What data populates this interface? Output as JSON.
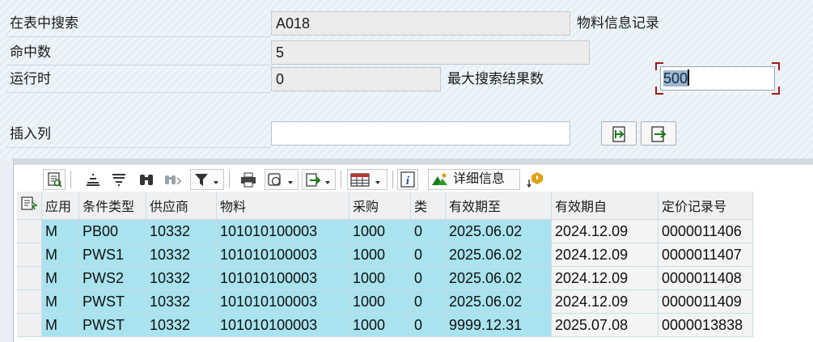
{
  "form": {
    "search_in_table": {
      "label": "在表中搜索",
      "value": "A018",
      "side_label": "物料信息记录"
    },
    "hits": {
      "label": "命中数",
      "value": "5"
    },
    "runtime": {
      "label": "运行时",
      "value": "0",
      "side_label": "最大搜索结果数"
    },
    "max_results": {
      "value": "500"
    },
    "insert_column": {
      "label": "插入列",
      "value": ""
    }
  },
  "toolbar": {
    "details_label": "详细信息",
    "icons": [
      "details-icon",
      "sort-ascending-icon",
      "sort-descending-icon",
      "find-icon",
      "find-next-icon",
      "filter-icon",
      "print-icon",
      "views-icon",
      "export-icon",
      "layout-icon",
      "info-icon",
      "detail-info-icon",
      "abc-analysis-icon"
    ]
  },
  "table": {
    "columns": [
      "应用",
      "条件类型",
      "供应商",
      "物料",
      "采购",
      "类",
      "有效期至",
      "有效期自",
      "定价记录号"
    ],
    "rows": [
      [
        "M",
        "PB00",
        "10332",
        "101010100003",
        "1000",
        "0",
        "2025.06.02",
        "2024.12.09",
        "0000011406"
      ],
      [
        "M",
        "PWS1",
        "10332",
        "101010100003",
        "1000",
        "0",
        "2025.06.02",
        "2024.12.09",
        "0000011407"
      ],
      [
        "M",
        "PWS2",
        "10332",
        "101010100003",
        "1000",
        "0",
        "2025.06.02",
        "2024.12.09",
        "0000011408"
      ],
      [
        "M",
        "PWST",
        "10332",
        "101010100003",
        "1000",
        "0",
        "2025.06.02",
        "2024.12.09",
        "0000011409"
      ],
      [
        "M",
        "PWST",
        "10332",
        "101010100003",
        "1000",
        "0",
        "9999.12.31",
        "2025.07.08",
        "0000013838"
      ]
    ]
  },
  "colors": {
    "key_cell": "#a9e3ef",
    "value_cell": "#f4f4f4",
    "focus_frame": "#a01818"
  }
}
